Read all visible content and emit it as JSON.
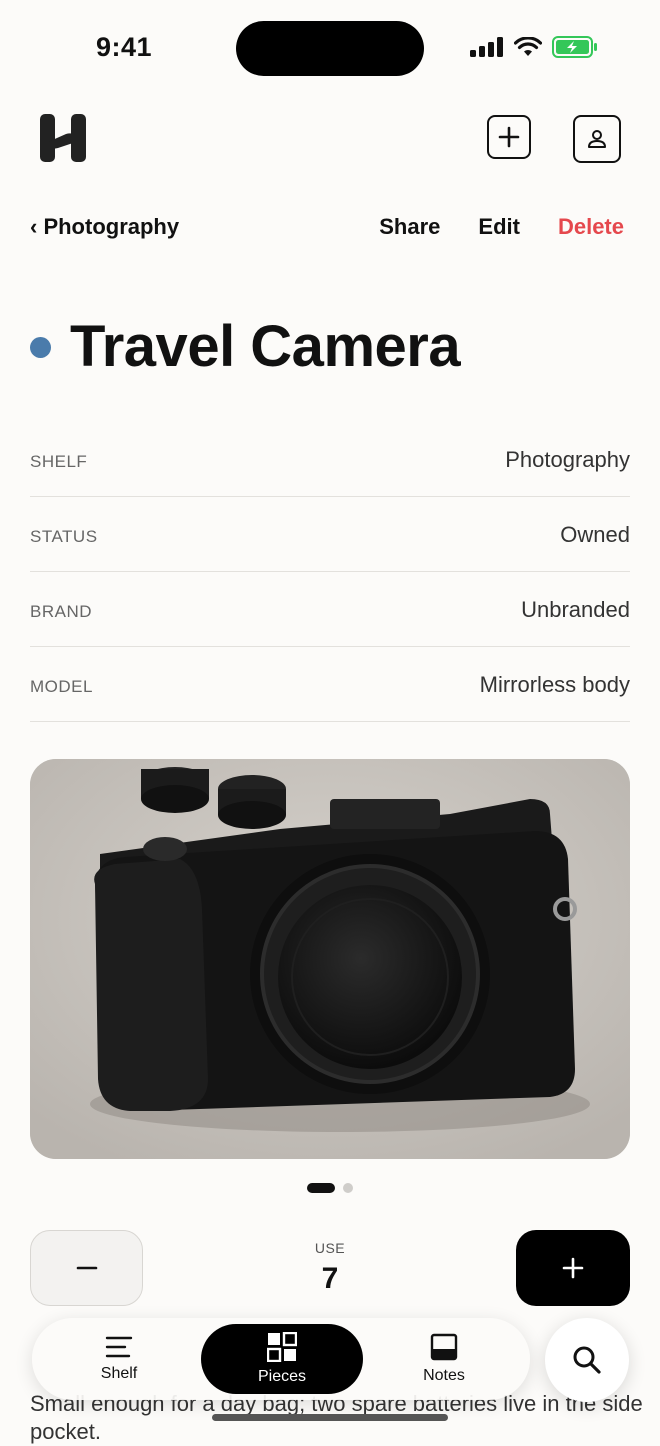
{
  "status_bar": {
    "time": "9:41"
  },
  "header": {
    "add_icon": "plus-square-icon",
    "profile_icon": "person-icon"
  },
  "nav": {
    "back_label": "‹ Photography",
    "share_label": "Share",
    "edit_label": "Edit",
    "delete_label": "Delete",
    "delete_color": "#e5484d"
  },
  "item": {
    "title": "Travel Camera",
    "dot_color": "#4a7bab",
    "details": [
      {
        "label": "SHELF",
        "value": "Photography"
      },
      {
        "label": "STATUS",
        "value": "Owned"
      },
      {
        "label": "BRAND",
        "value": "Unbranded"
      },
      {
        "label": "MODEL",
        "value": "Mirrorless body"
      }
    ],
    "photo_count": 2,
    "photo_active": 1
  },
  "use": {
    "label": "USE",
    "value": "7"
  },
  "notes_text": "Small enough for a day bag; two spare batteries live in the side pocket.",
  "tabs": [
    {
      "label": "Shelf",
      "icon": "shelf-lines-icon"
    },
    {
      "label": "Pieces",
      "icon": "grid-icon",
      "active": true
    },
    {
      "label": "Notes",
      "icon": "note-icon"
    }
  ],
  "search_icon": "search-icon"
}
